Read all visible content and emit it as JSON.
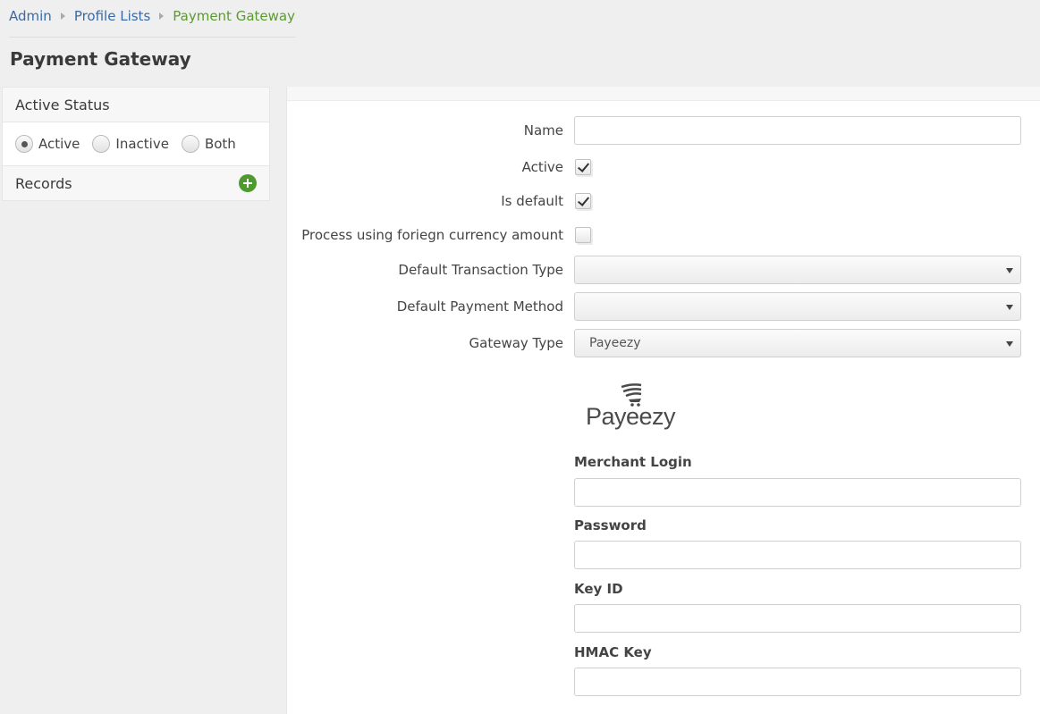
{
  "breadcrumb": {
    "items": [
      "Admin",
      "Profile Lists",
      "Payment Gateway"
    ]
  },
  "page_title": "Payment Gateway",
  "sidebar": {
    "active_status_header": "Active Status",
    "status_options": [
      "Active",
      "Inactive",
      "Both"
    ],
    "selected_status": "Active",
    "records_header": "Records",
    "add_icon": "plus-circle-icon"
  },
  "form": {
    "name_label": "Name",
    "name_value": "",
    "active_label": "Active",
    "active_checked": true,
    "is_default_label": "Is default",
    "is_default_checked": true,
    "foreign_currency_label": "Process using foriegn currency amount",
    "foreign_currency_checked": false,
    "transaction_type_label": "Default Transaction Type",
    "transaction_type_value": "",
    "payment_method_label": "Default Payment Method",
    "payment_method_value": "",
    "gateway_type_label": "Gateway Type",
    "gateway_type_value": "Payeezy"
  },
  "gateway": {
    "logo_text": "Payeezy",
    "merchant_login_label": "Merchant Login",
    "password_label": "Password",
    "key_id_label": "Key ID",
    "hmac_key_label": "HMAC Key"
  },
  "colors": {
    "link": "#3a6aa6",
    "current_crumb": "#5b9a2f",
    "add_button": "#4f9a2e"
  }
}
